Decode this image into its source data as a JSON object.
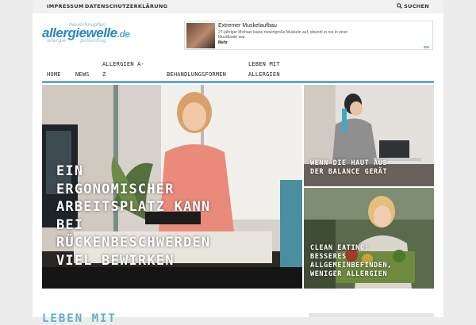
{
  "topbar": {
    "links": [
      "IMPRESSUM",
      "DATENSCHUTZERKLÄRUNG"
    ],
    "search_label": "SUCHEN"
  },
  "logo": {
    "tagline_top": "heuschnupfen",
    "name": "allergiewelle",
    "tld": ".de",
    "tagline_left": "allergie",
    "tagline_right": "pollenflug"
  },
  "ad": {
    "title": "Extremer Muskelaufbau",
    "text": "27-jähriger Michael baute riesengroße Muskeln auf, obwohl er nie in einer Muckibude war.",
    "more": "Mehr"
  },
  "nav": {
    "items": [
      {
        "line1": "HOME",
        "line2": ""
      },
      {
        "line1": "NEWS",
        "line2": ""
      },
      {
        "line1": "ALLERGIEN A-",
        "line2": "Z"
      },
      {
        "line1": "BEHANDLUNGSFORMEN",
        "line2": ""
      },
      {
        "line1": "LEBEN MIT",
        "line2": "ALLERGIEN"
      }
    ]
  },
  "featured": {
    "main_title": "EIN ERGONOMISCHER ARBEITSPLATZ KANN BEI RÜCKENBESCHWERDEN VIEL BEWIRKEN",
    "main_lines": [
      "EIN",
      "ERGONOMISCHER",
      "ARBEITSPLATZ KANN",
      "BEI",
      "RÜCKENBESCHWERDEN",
      "VIEL BEWIRKEN"
    ],
    "top_lines": [
      "WENN DIE HAUT AUS",
      "DER BALANCE GERÄT"
    ],
    "bottom_lines": [
      "CLEAN EATING:",
      "BESSERES",
      "ALLGEMEINBEFINDEN,",
      "WENIGER ALLERGIEN"
    ]
  },
  "section": {
    "heading": "LEBEN MIT"
  },
  "colors": {
    "accent": "#5fa8d8",
    "logo_blue": "#2b88c2",
    "topbar_bg": "#f1f1f1"
  }
}
